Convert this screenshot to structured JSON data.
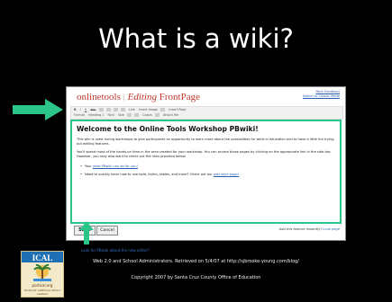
{
  "slide": {
    "title": "What is a wiki?",
    "attribution": "Web 2.0 and School Administrators. Retrieved on 5/4/07 at http://sjbrooke-young.com/blog/",
    "copyright": "Copyright 2007 by Santa Cruz County Office of Education"
  },
  "wiki": {
    "brand": "onlinetools",
    "separator": "|",
    "editing_label": "Editing",
    "page_name": "FrontPage",
    "user_links": [
      "Main Sandbox)",
      "Switch to Classic Mode"
    ],
    "toolbar_row1": [
      "B",
      "I",
      "U",
      "abc",
      "Link",
      "Insert Image",
      "Insert Page"
    ],
    "toolbar_row2": [
      "Format",
      "Heading 1",
      "Font",
      "Size",
      "Colors",
      "Attach file"
    ],
    "heading": "Welcome to the Online Tools Workshop PBwiki!",
    "intro": "This wiki is used during workshops to give participants an opportunity to learn more about the possibilities for wikis in education and to have a little fun trying out editing features.",
    "instructions": "You'll spend most of the hands-on time in the area created for your workshop. You can access those pages by clicking on the appropriate link in the side bar. However, you may also want to check out the links provided below.",
    "bullet1_prefix": "Your ",
    "bullet1_link": "what PBwiki can do for you!",
    "bullet2_prefix": "Need to quickly learn how to use bold, italics, tables, and more? Check out our ",
    "bullet2_link": "wiki style page!",
    "save_label": "Save",
    "cancel_label": "Cancel",
    "footer_note": "Add this feature instantly?",
    "footer_link": "Look page",
    "look_link": "Look for PBwiki about the new editor?"
  },
  "badge": {
    "title": "ICAL",
    "site": "portical.org",
    "tagline": "Portal for California School Leaders"
  },
  "colors": {
    "arrow": "#2bc58a",
    "brand": "#c0392b",
    "link": "#2a5db0"
  }
}
